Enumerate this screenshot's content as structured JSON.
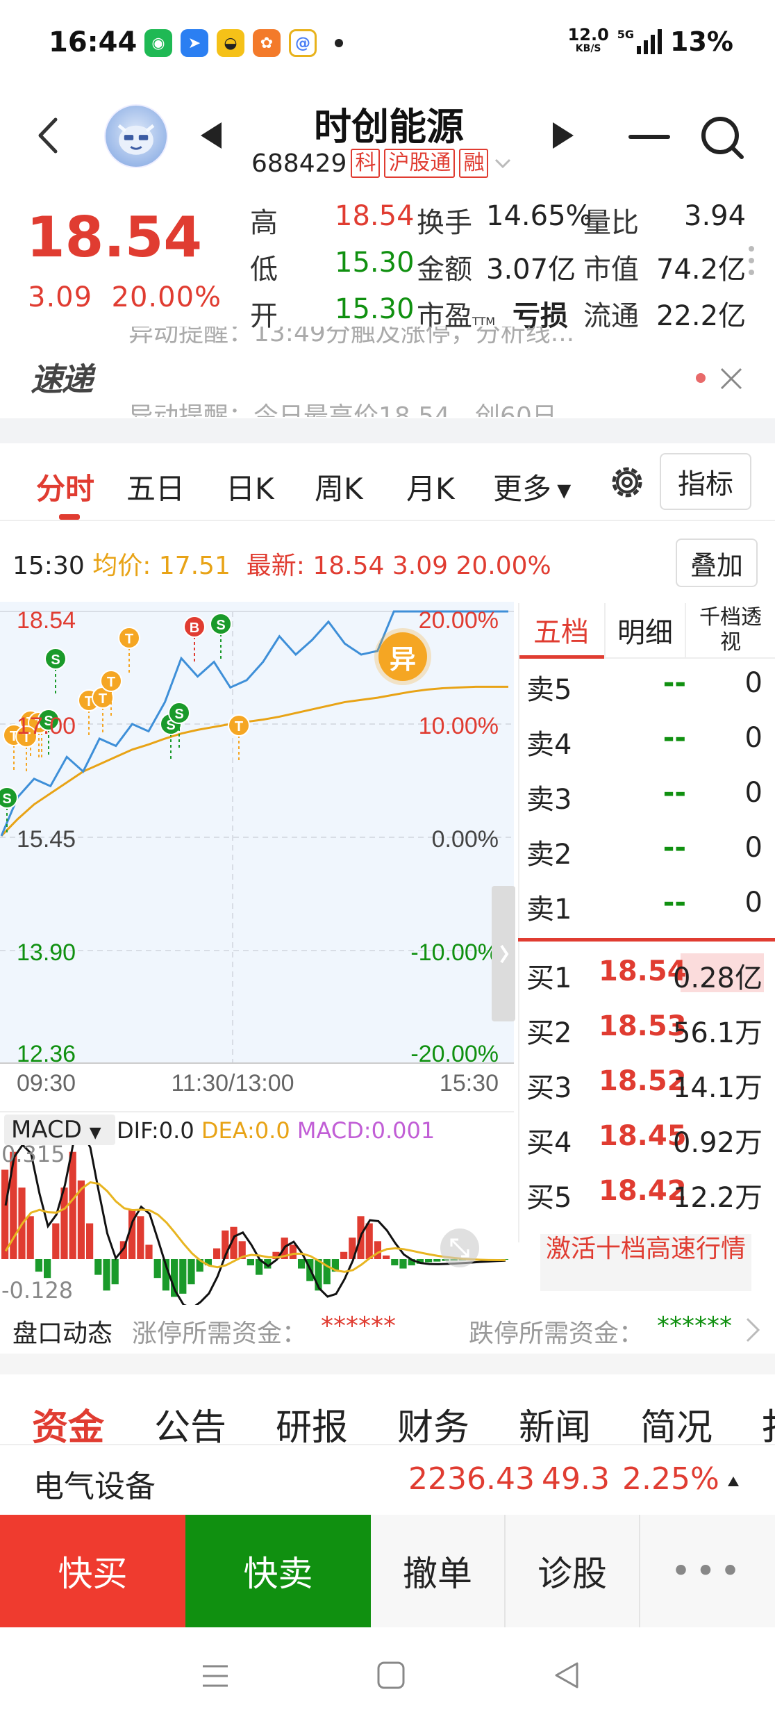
{
  "status_bar": {
    "time": "16:44",
    "net_speed": "12.0",
    "net_unit": "KB/S",
    "net_type": "5G",
    "battery": "13%",
    "apps": [
      "wechat-icon",
      "dingtalk-icon",
      "ride-icon",
      "market-icon",
      "browser-icon"
    ]
  },
  "header": {
    "stock_name": "时创能源",
    "stock_code": "688429",
    "tags": [
      "科",
      "沪股通",
      "融"
    ]
  },
  "quote": {
    "price": "18.54",
    "change": "3.09",
    "change_pct": "20.00%",
    "rows": [
      {
        "l1": "高",
        "v1": "18.54",
        "l2": "换手",
        "v2": "14.65%",
        "l3": "量比",
        "v3": "3.94"
      },
      {
        "l1": "低",
        "v1": "15.30",
        "l2": "金额",
        "v2": "3.07亿",
        "l3": "市值",
        "v3": "74.2亿"
      },
      {
        "l1": "开",
        "v1": "15.30",
        "l2": "市盈",
        "v2": "亏损",
        "l3": "流通",
        "v3": "22.2亿"
      }
    ],
    "pe_sub": "TTM"
  },
  "alert": {
    "top_text": "异动提醒：13:49分触及涨停，分析线...",
    "bottom_text": "异动提醒：今日最高价18.54，创60日",
    "logo": "速递"
  },
  "chart_tabs": {
    "tabs": [
      "分时",
      "五日",
      "日K",
      "周K",
      "月K",
      "更多"
    ],
    "indicator_label": "指标"
  },
  "info_line": {
    "time": "15:30",
    "avg_label": "均价:",
    "avg": "17.51",
    "latest_label": "最新:",
    "latest": "18.54",
    "change": "3.09",
    "pct": "20.00%",
    "overlay_label": "叠加"
  },
  "chart_data": {
    "type": "line",
    "y_ticks": [
      "18.54",
      "17.00",
      "15.45",
      "13.90",
      "12.36"
    ],
    "pct_ticks": [
      "20.00%",
      "10.00%",
      "0.00%",
      "-10.00%",
      "-20.00%"
    ],
    "x_ticks": [
      "09:30",
      "11:30/13:00",
      "15:30"
    ],
    "ylim": [
      12.36,
      18.54
    ],
    "series": [
      {
        "color": "#3e8fd8",
        "values": [
          15.47,
          16.0,
          16.25,
          16.15,
          16.55,
          16.35,
          16.8,
          16.7,
          17.0,
          16.9,
          17.3,
          17.9,
          17.65,
          17.85,
          17.5,
          17.6,
          17.85,
          18.2,
          17.95,
          18.15,
          18.4,
          18.1,
          17.95,
          18.0,
          18.54,
          18.54,
          18.54,
          18.54,
          18.54,
          18.54,
          18.54,
          18.54
        ]
      },
      {
        "color": "#e8a316",
        "values": [
          15.47,
          15.7,
          15.9,
          16.05,
          16.2,
          16.35,
          16.45,
          16.55,
          16.65,
          16.72,
          16.8,
          16.87,
          16.92,
          16.96,
          17.0,
          17.03,
          17.06,
          17.1,
          17.15,
          17.2,
          17.25,
          17.3,
          17.33,
          17.36,
          17.4,
          17.44,
          17.47,
          17.49,
          17.5,
          17.51,
          17.51,
          17.51
        ]
      }
    ],
    "markers": [
      "S",
      "T",
      "T",
      "T",
      "S",
      "T",
      "T",
      "T",
      "T",
      "S",
      "S",
      "B",
      "S",
      "T",
      "T",
      "S",
      "T"
    ],
    "anomaly_badge": "异"
  },
  "macd": {
    "label": "MACD",
    "dif_label": "DIF:",
    "dif": "0.0",
    "dea_label": "DEA:",
    "dea": "0.0",
    "macd_label": "MACD:",
    "macd_val": "0.001",
    "max": "0.315",
    "min": "-0.128",
    "bars": [
      0.25,
      0.3,
      0.2,
      0.12,
      -0.04,
      -0.06,
      0.1,
      0.2,
      0.3,
      0.22,
      0.1,
      -0.05,
      -0.1,
      -0.08,
      0.05,
      0.14,
      0.12,
      0.04,
      -0.06,
      -0.1,
      -0.12,
      -0.11,
      -0.08,
      -0.04,
      -0.02,
      0.03,
      0.08,
      0.09,
      0.05,
      -0.02,
      -0.05,
      -0.03,
      0.02,
      0.06,
      0.04,
      -0.03,
      -0.07,
      -0.1,
      -0.08,
      -0.04,
      0.02,
      0.06,
      0.12,
      0.1,
      0.05,
      0.01,
      -0.02,
      -0.03,
      -0.02,
      -0.015,
      -0.01,
      -0.008,
      -0.006,
      -0.005,
      -0.004,
      -0.003,
      -0.002,
      -0.002,
      -0.001,
      -0.001
    ]
  },
  "order_book": {
    "tabs": [
      "五档",
      "明细",
      "千档透视"
    ],
    "sells": [
      {
        "label": "卖5",
        "price": "--",
        "vol": "0"
      },
      {
        "label": "卖4",
        "price": "--",
        "vol": "0"
      },
      {
        "label": "卖3",
        "price": "--",
        "vol": "0"
      },
      {
        "label": "卖2",
        "price": "--",
        "vol": "0"
      },
      {
        "label": "卖1",
        "price": "--",
        "vol": "0"
      }
    ],
    "buys": [
      {
        "label": "买1",
        "price": "18.54",
        "vol": "0.28亿"
      },
      {
        "label": "买2",
        "price": "18.53",
        "vol": "56.1万"
      },
      {
        "label": "买3",
        "price": "18.52",
        "vol": "14.1万"
      },
      {
        "label": "买4",
        "price": "18.45",
        "vol": "0.92万"
      },
      {
        "label": "买5",
        "price": "18.42",
        "vol": "12.2万"
      }
    ],
    "activate_label": "激活十档高速行情"
  },
  "pankou": {
    "title": "盘口动态",
    "limit_up_label": "涨停所需资金：",
    "limit_up_val": "******",
    "limit_down_label": "跌停所需资金：",
    "limit_down_val": "******"
  },
  "bottom_tabs": [
    "资金",
    "公告",
    "研报",
    "财务",
    "新闻",
    "简况",
    "扌"
  ],
  "sector": {
    "name": "电气设备",
    "value": "2236.43",
    "change": "49.3",
    "pct": "2.25%"
  },
  "actions": {
    "buy": "快买",
    "sell": "快卖",
    "cancel": "撤单",
    "diagnose": "诊股",
    "more": "•••"
  },
  "colors": {
    "up": "#e03c31",
    "down": "#109010",
    "avg_line": "#e8a316",
    "price_line": "#3e8fd8",
    "buy_btn": "#ef3b2f",
    "sell_btn": "#109010"
  }
}
